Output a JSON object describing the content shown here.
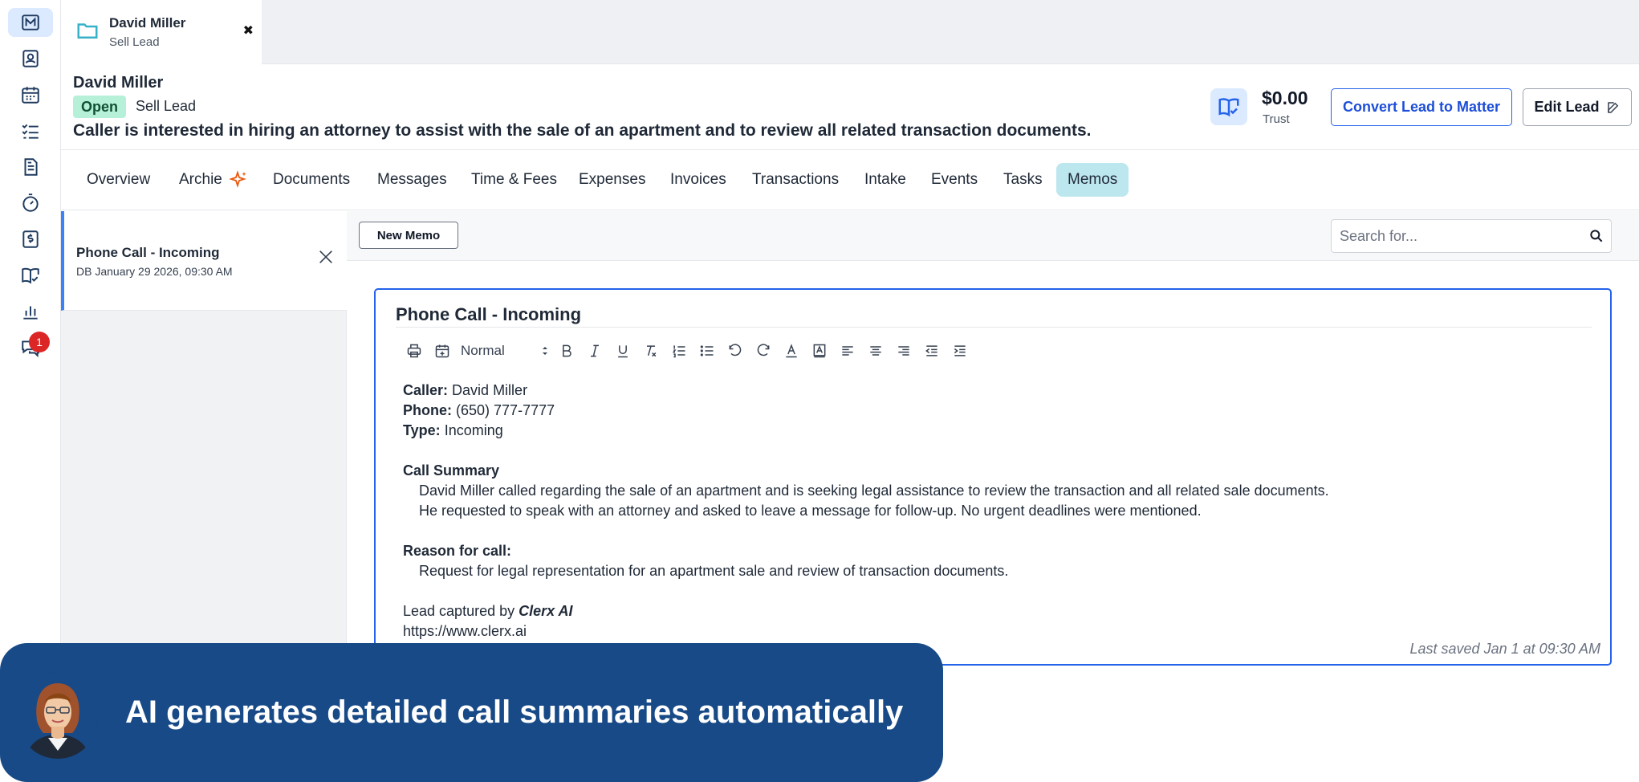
{
  "rail": {
    "notifications_badge": "1"
  },
  "tab": {
    "title": "David Miller",
    "subtitle": "Sell Lead",
    "close": "✖"
  },
  "lead": {
    "name": "David Miller",
    "status": "Open",
    "type": "Sell Lead",
    "description": "Caller is interested in hiring an attorney to assist with the sale of an apartment and to review all related transaction documents."
  },
  "trust": {
    "amount": "$0.00",
    "label": "Trust"
  },
  "actions": {
    "convert_label": "Convert Lead to Matter",
    "edit_label": "Edit Lead"
  },
  "nav": {
    "tabs": [
      {
        "label": "Overview"
      },
      {
        "label": "Archie"
      },
      {
        "label": "Documents"
      },
      {
        "label": "Messages"
      },
      {
        "label": "Time & Fees"
      },
      {
        "label": "Expenses"
      },
      {
        "label": "Invoices"
      },
      {
        "label": "Transactions"
      },
      {
        "label": "Intake"
      },
      {
        "label": "Events"
      },
      {
        "label": "Tasks"
      },
      {
        "label": "Memos"
      }
    ],
    "active": "Memos"
  },
  "memo_list": {
    "items": [
      {
        "title": "Phone Call - Incoming",
        "meta": "DB January 29 2026, 09:30 AM"
      }
    ]
  },
  "memo_bar": {
    "new_label": "New Memo",
    "search_placeholder": "Search for..."
  },
  "editor": {
    "title": "Phone Call - Incoming",
    "format_value": "Normal",
    "caller_label": "Caller:",
    "caller_value": "David Miller",
    "phone_label": "Phone:",
    "phone_value": "(650) 777-7777",
    "type_label": "Type:",
    "type_value": "Incoming",
    "summary_heading": "Call Summary",
    "summary_line1": "David Miller called regarding the sale of an apartment and is seeking legal assistance to review the transaction and all related sale documents.",
    "summary_line2": "He requested to speak with an attorney and asked to leave a message for follow-up. No urgent deadlines were mentioned.",
    "reason_heading": "Reason for call:",
    "reason_line": "Request for legal representation for an apartment sale and review of transaction documents.",
    "captured_prefix": "Lead captured by",
    "captured_by": "Clerx AI",
    "url": "https://www.clerx.ai",
    "saved": "Last saved Jan 1 at 09:30 AM"
  },
  "banner": {
    "text": "AI generates detailed call summaries automatically"
  },
  "colors": {
    "accent": "#2563eb",
    "active_tab": "#bde7ef",
    "status_open": "#b7f0d8",
    "banner": "#174a87",
    "badge": "#dc2626"
  }
}
